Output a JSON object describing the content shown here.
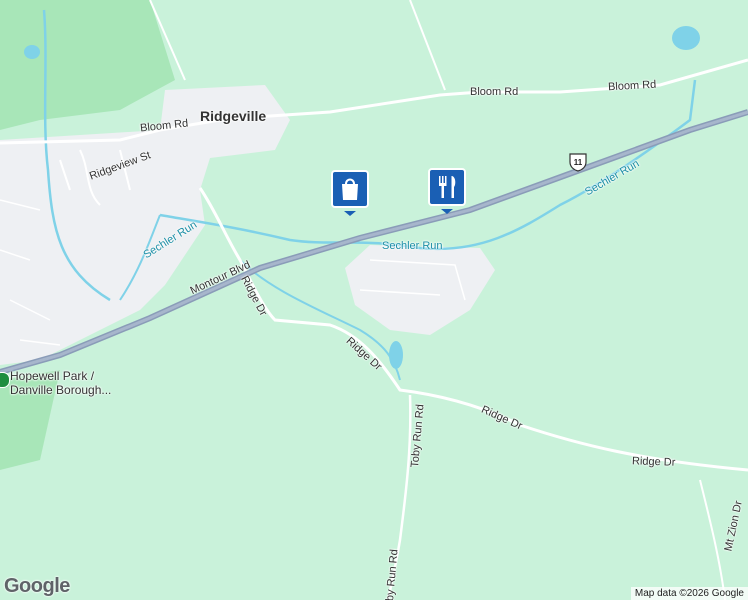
{
  "map": {
    "town": "Ridgeville",
    "roads": {
      "bloom_rd_1": "Bloom Rd",
      "bloom_rd_2": "Bloom Rd",
      "bloom_rd_3": "Bloom Rd",
      "ridgeview_st": "Ridgeview St",
      "montour_blvd": "Montour Blvd",
      "ridge_dr_1": "Ridge Dr",
      "ridge_dr_2": "Ridge Dr",
      "ridge_dr_3": "Ridge Dr",
      "ridge_dr_4": "Ridge Dr",
      "toby_run_rd_1": "Toby Run Rd",
      "toby_run_rd_2": "Toby Run Rd",
      "mt_zion_dr": "Mt Zion Dr"
    },
    "water": {
      "sechler_run_1": "Sechler Run",
      "sechler_run_2": "Sechler Run",
      "sechler_run_3": "Sechler Run"
    },
    "route_shield": "11",
    "poi": {
      "park_line1": "Hopewell Park /",
      "park_line2": "Danville Borough..."
    },
    "markers": [
      {
        "name": "shopping",
        "icon": "shopping-bag-icon"
      },
      {
        "name": "restaurant",
        "icon": "fork-knife-icon"
      }
    ],
    "colors": {
      "land": "#c9f2da",
      "park": "#a8e6b8",
      "urban": "#eef0f3",
      "highway": "#8a9cb8",
      "water": "#7fd2e8",
      "marker": "#1a5fb4"
    }
  },
  "branding": {
    "logo": "Google",
    "attribution": "Map data ©2026 Google"
  }
}
